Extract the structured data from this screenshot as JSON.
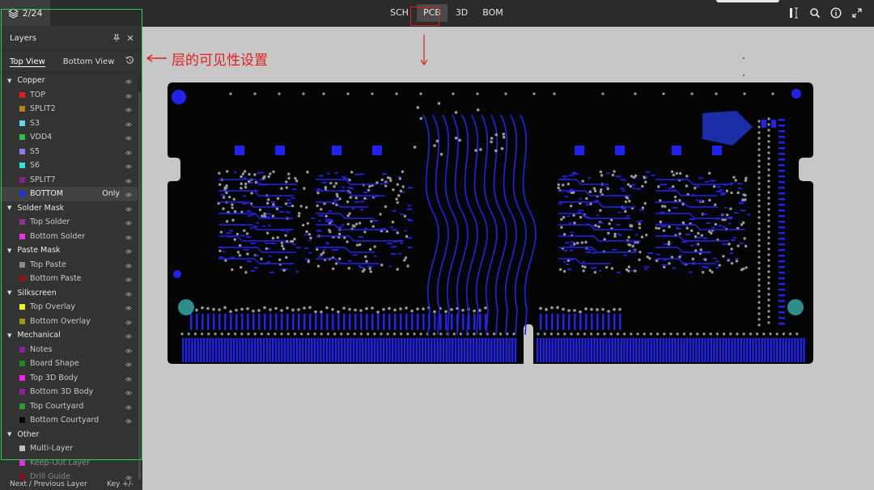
{
  "topbar": {
    "page_indicator": "2/24",
    "tabs": [
      {
        "label": "SCH",
        "active": false
      },
      {
        "label": "PCB",
        "active": true
      },
      {
        "label": "3D",
        "active": false
      },
      {
        "label": "BOM",
        "active": false
      }
    ],
    "tools": [
      "measure-icon",
      "search-icon",
      "info-icon",
      "fullscreen-icon"
    ]
  },
  "layers_panel": {
    "title": "Layers",
    "views": [
      {
        "label": "Top View",
        "active": true
      },
      {
        "label": "Bottom View",
        "active": false
      }
    ],
    "groups": [
      {
        "label": "Copper",
        "layers": [
          {
            "label": "TOP",
            "color": "#e21b1b"
          },
          {
            "label": "SPLIT2",
            "color": "#b8860b"
          },
          {
            "label": "S3",
            "color": "#5fd5f0"
          },
          {
            "label": "VDD4",
            "color": "#2bbf4a"
          },
          {
            "label": "S5",
            "color": "#8c7cf0"
          },
          {
            "label": "S6",
            "color": "#30e0e0"
          },
          {
            "label": "SPLIT7",
            "color": "#8e1f8e"
          },
          {
            "label": "BOTTOM",
            "color": "#1f2cf0",
            "selected": true,
            "only": "Only"
          }
        ]
      },
      {
        "label": "Solder Mask",
        "layers": [
          {
            "label": "Top Solder",
            "color": "#9b2a9b"
          },
          {
            "label": "Bottom Solder",
            "color": "#f030e0"
          }
        ]
      },
      {
        "label": "Paste Mask",
        "layers": [
          {
            "label": "Top Paste",
            "color": "#8a8a8a"
          },
          {
            "label": "Bottom Paste",
            "color": "#9b1010"
          }
        ]
      },
      {
        "label": "Silkscreen",
        "layers": [
          {
            "label": "Top Overlay",
            "color": "#f0f020"
          },
          {
            "label": "Bottom Overlay",
            "color": "#9a9a10"
          }
        ]
      },
      {
        "label": "Mechanical",
        "layers": [
          {
            "label": "Notes",
            "color": "#8a1fa0"
          },
          {
            "label": "Board Shape",
            "color": "#1e8a1e"
          },
          {
            "label": "Top 3D Body",
            "color": "#f020f0"
          },
          {
            "label": "Bottom 3D Body",
            "color": "#8a1fa0"
          },
          {
            "label": "Top Courtyard",
            "color": "#28a028"
          },
          {
            "label": "Bottom Courtyard",
            "color": "#050505"
          }
        ]
      },
      {
        "label": "Other",
        "no_eye": true,
        "layers": [
          {
            "label": "Multi-Layer",
            "color": "#c0c0c0",
            "no_eye": true
          },
          {
            "label": "Keep-Out Layer",
            "color": "#e030e0",
            "no_eye": true,
            "dim": true
          },
          {
            "label": "Drill Guide",
            "color": "#8a1010",
            "dim": true
          }
        ]
      }
    ],
    "footer_left": "Next / Previous Layer",
    "footer_right": "Key +/-"
  },
  "annotation": {
    "text": "层的可见性设置",
    "color": "#e02020"
  }
}
